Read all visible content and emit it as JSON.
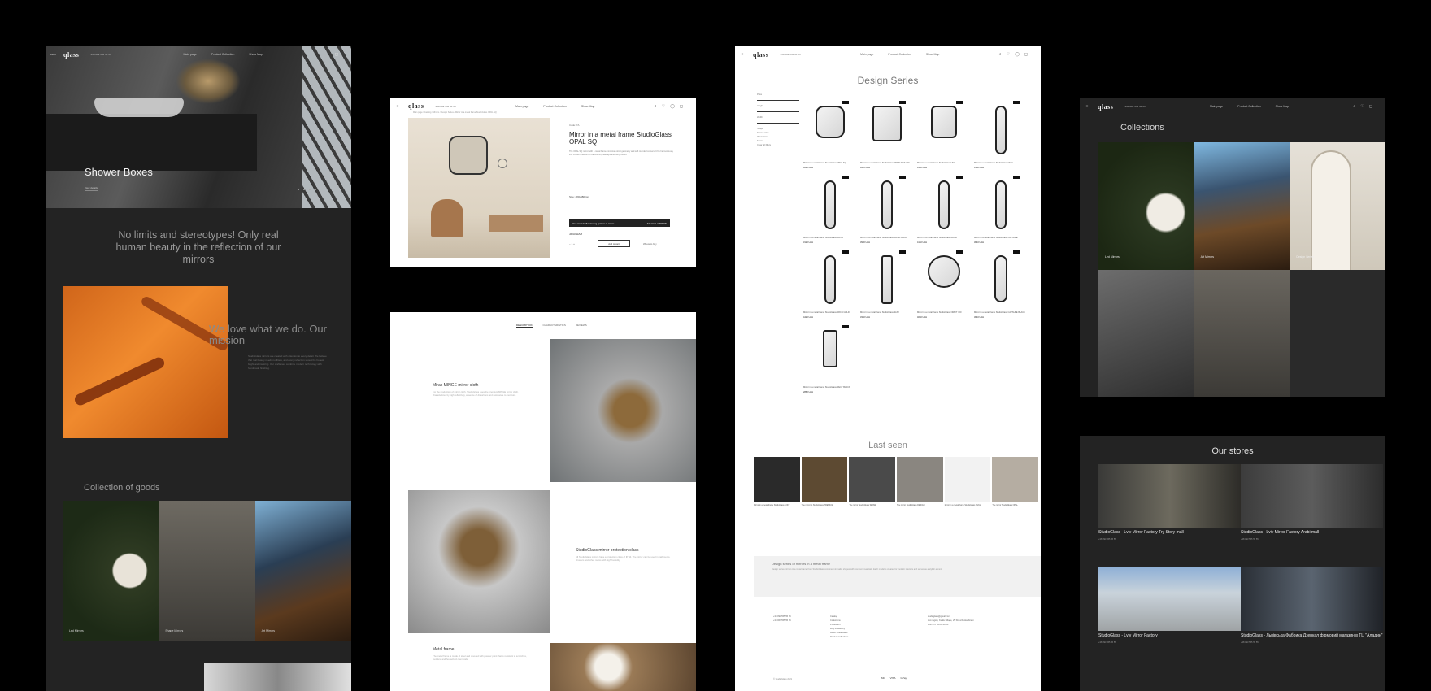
{
  "brand": {
    "logo": "qlass",
    "phone": "+38 093 555 55 55"
  },
  "nav": [
    "Main page",
    "Product Collection",
    "Show Map"
  ],
  "home": {
    "menu_label": "Menu",
    "hero_title": "Shower Boxes",
    "hero_link": "View details",
    "slogan": "No limits and stereotypes! Only real human beauty in the reflection of our mirrors",
    "mission_title": "We love what we do. Our mission",
    "mission_text": "StudioGlass mirrors are created with attention to every detail. We believe that real beauty needs no filters, and every reflection should be honest, bright and inspiring. Our craftsmen combine modern technology with handmade finishing.",
    "collection_title": "Collection of goods",
    "collection_items": [
      "Led Mirrors",
      "Shape Mirrors",
      "Art Mirrors"
    ]
  },
  "product": {
    "breadcrumb": "Main page / Catalog / Mirrors / Design Series / Mirror in a metal frame StudioGlass OPAL SQ",
    "code": "Code: 7A",
    "title": "Mirror in a metal frame StudioGlass OPAL SQ",
    "description": "The OPAL SQ mirror with a metal frame combines strict geometry and soft rounded corners. It fits harmoniously into modern interiors of bathrooms, hallways and living rooms.",
    "option_label": "Size",
    "option_value": "480x480 mm",
    "bar_text": "You can add illuminating options to mirror",
    "bar_value": "+420 UAH / OPTION",
    "price": "3640 UAH",
    "qty": "1",
    "cart": "Add to cart",
    "store": "Where to buy"
  },
  "details": {
    "tabs": [
      "DESCRIPTION",
      "CHARACTERISTICS",
      "REVIEWS"
    ],
    "blocks": [
      {
        "title": "Mirax MINGE mirror cloth",
        "text": "For the production of mirror cloth, StudioGlass uses the premium MINGE mirror cloth, characterized by high reflectivity, absence of distortions and resistance to moisture."
      },
      {
        "title": "StudioGlass mirror protection class",
        "text": "All StudioGlass mirrors have a protection class of IP 44. The mirror can be used in bathrooms, showers and other rooms with high humidity."
      },
      {
        "title": "Metal frame",
        "text": "The metal frame is made of steel and covered with powder paint that is resistant to scratches, moisture and household chemicals."
      }
    ]
  },
  "catalog": {
    "title": "Design Series",
    "filters": [
      "Price",
      "Height",
      "Width",
      "Shape",
      "Frame color",
      "Illumination",
      "Series",
      "Clear all filters"
    ],
    "products": [
      {
        "name": "Mirror in a metal frame StudioGlass OPAL SQ",
        "price": "3640 UAH"
      },
      {
        "name": "Mirror in a metal frame StudioGlass AMETHYST 700",
        "price": "4420 UAH"
      },
      {
        "name": "Mirror in a metal frame StudioGlass HEX",
        "price": "4160 UAH"
      },
      {
        "name": "Mirror in a metal frame StudioGlass OVAL",
        "price": "3380 UAH"
      },
      {
        "name": "Mirror in a metal frame StudioGlass ALICE",
        "price": "3120 UAH"
      },
      {
        "name": "Mirror in a metal frame StudioGlass ALICE GOLD",
        "price": "3900 UAH"
      },
      {
        "name": "Mirror in a metal frame StudioGlass ARCH",
        "price": "4160 UAH"
      },
      {
        "name": "Mirror in a metal frame StudioGlass CAPSULE",
        "price": "3640 UAH"
      },
      {
        "name": "Mirror in a metal frame StudioGlass ARCH GOLD",
        "price": "4420 UAH"
      },
      {
        "name": "Mirror in a metal frame StudioGlass SLIM",
        "price": "3380 UAH"
      },
      {
        "name": "Mirror in a metal frame StudioGlass ORBIT 700",
        "price": "4680 UAH"
      },
      {
        "name": "Mirror in a metal frame StudioGlass CAPSULE BLACK",
        "price": "3640 UAH"
      },
      {
        "name": "Mirror in a metal frame StudioGlass RECT BLACK",
        "price": "2860 UAH"
      }
    ],
    "last_seen_title": "Last seen",
    "last_seen": [
      "Mirror in a metal frame StudioGlass LOFT",
      "The mirror in StudioGlass PREMIUM",
      "The mirror StudioGlass SENSE",
      "The mirror StudioGlass DESIGN",
      "Mirror in a metal frame StudioGlass OVAL",
      "The mirror StudioGlass OPAL"
    ],
    "seo_title": "Design series of mirrors in a metal frame",
    "seo_text": "Design series mirrors in a metal frame from StudioGlass combine minimalist shapes with premium materials. Each model is created for modern interiors and serves as a stylish accent.",
    "footer": {
      "phones": [
        "+38 093 555 55 55",
        "+38 067 555 55 55"
      ],
      "links": [
        "Catalog",
        "Collections",
        "Production",
        "Way of Delivery",
        "About StudioGlass",
        "Product Collections"
      ],
      "email": "studioglass@gmail.com",
      "address": "Lviv region, Kulikiv village, 25 Shevchenka Street",
      "hours": "Mon–Fri: 09:00–18:00",
      "payments": [
        "VISA",
        "MC",
        "GPay"
      ],
      "copyright": "© StudioGlass 2021"
    }
  },
  "collections": {
    "title": "Collections",
    "items": [
      "Led Mirrors",
      "Art Mirrors",
      "Design Series",
      "",
      "",
      ""
    ]
  },
  "stores": {
    "title": "Our stores",
    "items": [
      {
        "name": "StudioGlass - Lviv Mirror Factory Try Story mall",
        "phone": "+38 093 555 55 55",
        "email": "sales@studioglass.com"
      },
      {
        "name": "StudioGlass - Lviv Mirror Factory Arabi mall",
        "phone": "+38 093 555 55 55",
        "email": "sales@studioglass.com"
      },
      {
        "name": "StudioGlass - Lviv Mirror Factory",
        "phone": "+38 093 555 55 55",
        "email": "sales@studioglass.com"
      },
      {
        "name": "StudioGlass - Львівська Фабрика Дзеркал фірмовий магазин в ТЦ \"Аладин\"",
        "phone": "+38 093 555 55 55",
        "email": "studioglass.lviv@gmail.com"
      }
    ]
  }
}
